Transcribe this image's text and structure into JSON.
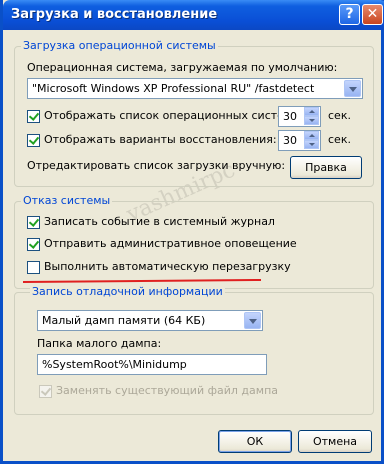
{
  "window": {
    "title": "Загрузка и восстановление",
    "help_symbol": "?",
    "close_symbol": "✕"
  },
  "startup": {
    "legend": "Загрузка операционной системы",
    "default_os_label": "Операционная система, загружаемая по умолчанию:",
    "default_os_value": "\"Microsoft Windows XP Professional RU\" /fastdetect",
    "show_list_label": "Отображать список операционных систем:",
    "show_list_checked": true,
    "show_list_seconds": "30",
    "show_recovery_label": "Отображать варианты восстановления:",
    "show_recovery_checked": true,
    "show_recovery_seconds": "30",
    "seconds_unit": "сек.",
    "edit_label": "Отредактировать список загрузки вручную:",
    "edit_button": "Правка"
  },
  "failure": {
    "legend": "Отказ системы",
    "write_event_label": "Записать событие в системный журнал",
    "write_event_checked": true,
    "send_alert_label": "Отправить административное оповещение",
    "send_alert_checked": true,
    "auto_restart_label": "Выполнить автоматическую перезагрузку",
    "auto_restart_checked": false
  },
  "debug": {
    "legend": "Запись отладочной информации",
    "dump_type": "Малый дамп памяти (64 КБ)",
    "folder_label": "Папка малого дампа:",
    "folder_value": "%SystemRoot%\\Minidump",
    "overwrite_label": "Заменять существующий файл дампа",
    "overwrite_checked": true,
    "overwrite_enabled": false
  },
  "footer": {
    "ok": "ОК",
    "cancel": "Отмена"
  },
  "watermark": "vashmirpc"
}
